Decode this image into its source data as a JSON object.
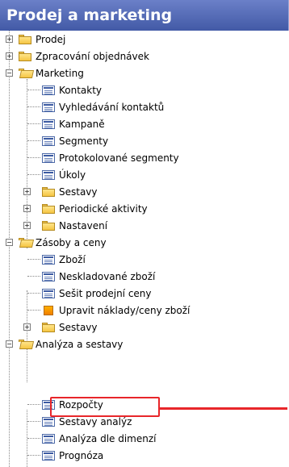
{
  "panel": {
    "title": "Prodej a marketing",
    "header_color": "#4f65b3",
    "highlight_color": "#e8262a"
  },
  "tree": {
    "prodej": "Prodej",
    "zpracovani": "Zpracování objednávek",
    "marketing": "Marketing",
    "kontakty": "Kontakty",
    "vyhledavani": "Vyhledávání kontaktů",
    "kampane": "Kampaně",
    "segmenty": "Segmenty",
    "protokolovane": "Protokolované segmenty",
    "ukoly": "Úkoly",
    "sestavy_m": "Sestavy",
    "periodicke": "Periodické aktivity",
    "nastaveni": "Nastavení",
    "zasoby": "Zásoby a ceny",
    "zbozi": "Zboží",
    "neskladovane": "Neskladované zboží",
    "sesit": "Sešit prodejní ceny",
    "upravit": "Upravit náklady/ceny zboží",
    "sestavy_z": "Sestavy",
    "analyza": "Analýza a sestavy",
    "rozpocty": "Rozpočty",
    "sestavy_analyz": "Sestavy analýz",
    "analyza_dimenzi": "Analýza dle dimenzí",
    "prognoza": "Prognóza"
  }
}
